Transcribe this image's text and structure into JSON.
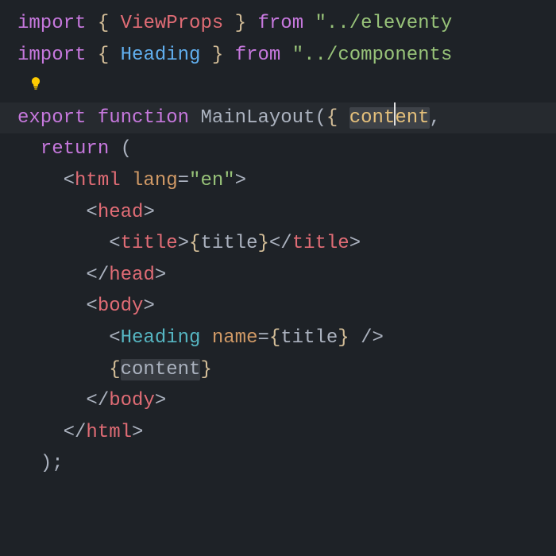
{
  "code": {
    "line1": {
      "import": "import",
      "lbrace": "{",
      "ident": "ViewProps",
      "rbrace": "}",
      "from": "from",
      "strOpen": "\"",
      "strPath": "../eleventy",
      "strClose": ""
    },
    "line2": {
      "import": "import",
      "lbrace": "{",
      "ident": "Heading",
      "rbrace": "}",
      "from": "from",
      "strOpen": "\"",
      "strPath": "../components",
      "strClose": ""
    },
    "line4": {
      "export": "export",
      "function": "function",
      "name": "MainLayout",
      "lparen": "(",
      "lbrace": "{",
      "param1a": "cont",
      "param1b": "ent",
      "comma": ","
    },
    "line5": {
      "return": "return",
      "lparen": "("
    },
    "line6": {
      "lt": "<",
      "tag": "html",
      "attr": "lang",
      "eq": "=",
      "val": "\"en\"",
      "gt": ">"
    },
    "line7": {
      "lt": "<",
      "tag": "head",
      "gt": ">"
    },
    "line8": {
      "lt1": "<",
      "tag1": "title",
      "gt1": ">",
      "lb": "{",
      "expr": "title",
      "rb": "}",
      "lt2": "</",
      "tag2": "title",
      "gt2": ">"
    },
    "line9": {
      "lt": "</",
      "tag": "head",
      "gt": ">"
    },
    "line10": {
      "lt": "<",
      "tag": "body",
      "gt": ">"
    },
    "line11": {
      "lt": "<",
      "tag": "Heading",
      "attr": "name",
      "eq": "=",
      "lb": "{",
      "expr": "title",
      "rb": "}",
      "close": "/>"
    },
    "line12": {
      "lb": "{",
      "expr": "content",
      "rb": "}"
    },
    "line13": {
      "lt": "</",
      "tag": "body",
      "gt": ">"
    },
    "line14": {
      "lt": "</",
      "tag": "html",
      "gt": ">"
    },
    "line15": {
      "rparen": ")",
      "semi": ";"
    }
  }
}
